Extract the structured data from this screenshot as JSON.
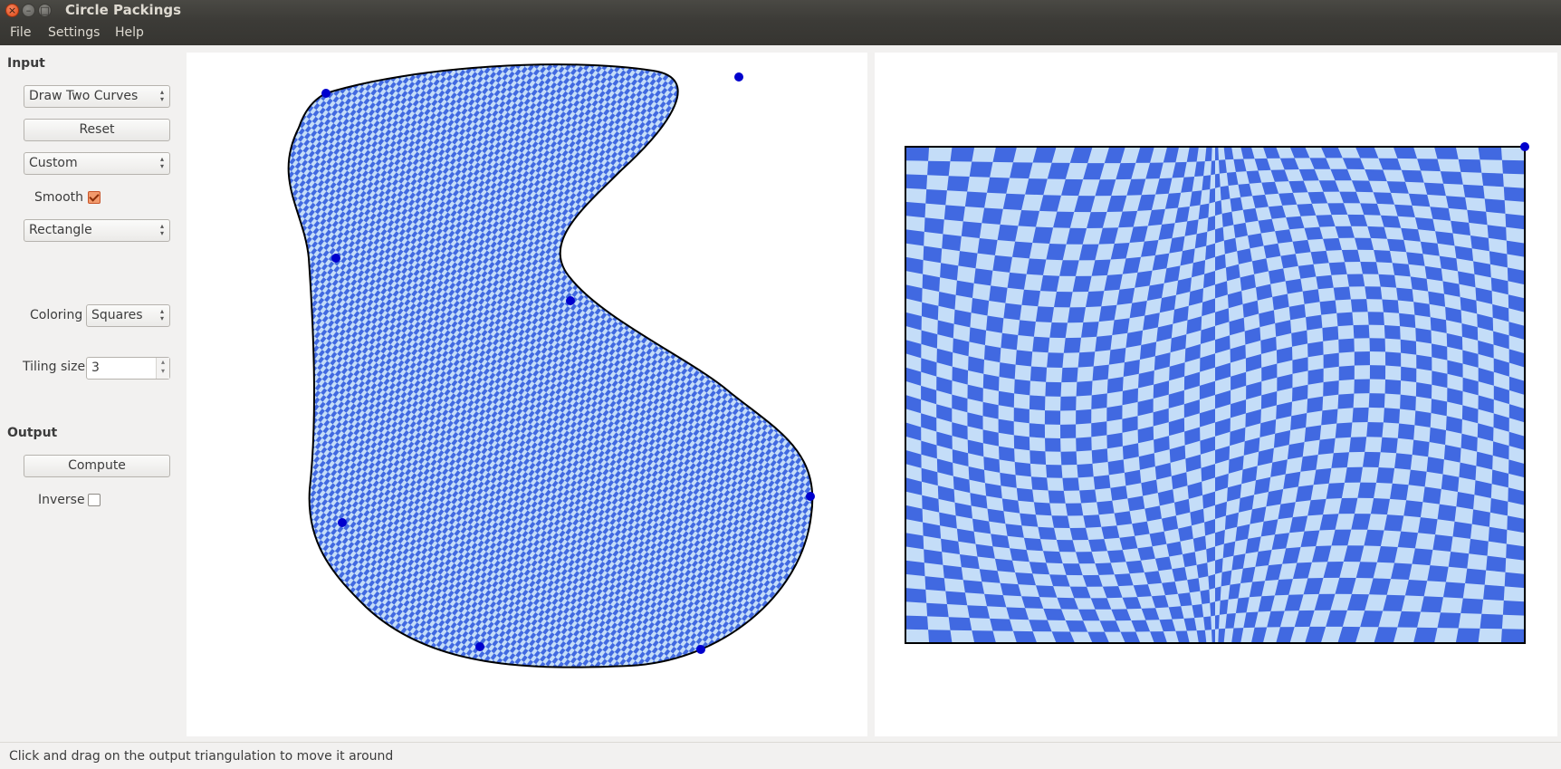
{
  "window": {
    "title": "Circle Packings",
    "close_glyph": "×",
    "min_glyph": "–",
    "max_glyph": "□"
  },
  "menu": {
    "file": "File",
    "settings": "Settings",
    "help": "Help"
  },
  "input_section": {
    "label": "Input",
    "mode_select": "Draw Two Curves",
    "reset_button": "Reset",
    "preset_select": "Custom",
    "smooth_label": "Smooth",
    "smooth_checked": true,
    "shape_select": "Rectangle",
    "coloring_label": "Coloring",
    "coloring_select": "Squares",
    "tiling_label": "Tiling size",
    "tiling_value": "3"
  },
  "output_section": {
    "label": "Output",
    "compute_button": "Compute",
    "inverse_label": "Inverse",
    "inverse_checked": false
  },
  "colors": {
    "tile_dark": "#4169e1",
    "tile_light": "#c4ddf8",
    "control_point": "#0000cd"
  },
  "status": {
    "text": "Click and drag on the output triangulation to move it around"
  }
}
